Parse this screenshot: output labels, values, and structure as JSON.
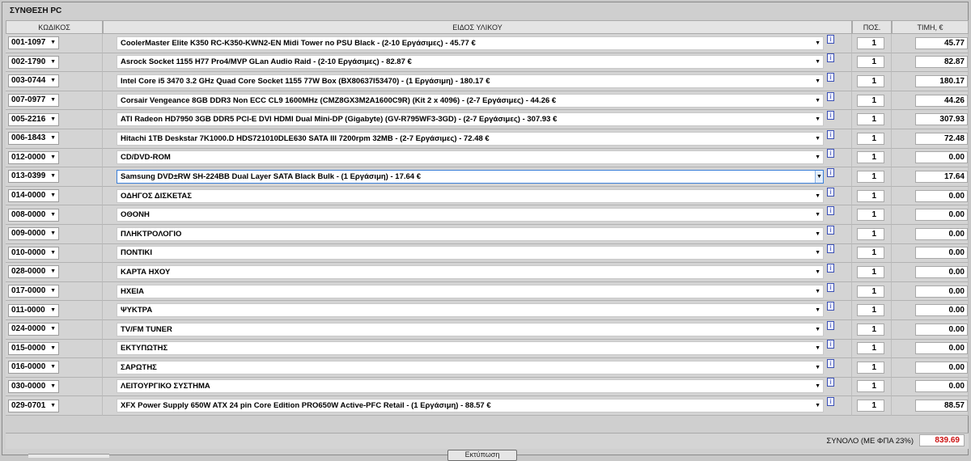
{
  "panel_title": "ΣΥΝΘΕΣΗ PC",
  "columns": {
    "code": "ΚΩΔΙΚΟΣ",
    "item": "ΕΙΔΟΣ ΥΛΙΚΟΥ",
    "qty": "ΠΟΣ.",
    "price": "ΤΙΜΗ, €"
  },
  "info_glyph": "i",
  "rows": [
    {
      "code": "001-1097",
      "item": "CoolerMaster Elite K350 RC-K350-KWN2-EN Midi Tower no PSU Black - (2-10 Εργάσιμες) - 45.77 €",
      "qty": "1",
      "price": "45.77"
    },
    {
      "code": "002-1790",
      "item": "Asrock Socket 1155 H77 Pro4/MVP GLan Audio Raid - (2-10 Εργάσιμες) - 82.87 €",
      "qty": "1",
      "price": "82.87"
    },
    {
      "code": "003-0744",
      "item": "Intel Core i5 3470 3.2 GHz Quad Core Socket 1155 77W Box (BX80637I53470) - (1 Εργάσιμη) - 180.17 €",
      "qty": "1",
      "price": "180.17"
    },
    {
      "code": "007-0977",
      "item": "Corsair Vengeance 8GB DDR3 Non ECC CL9 1600MHz (CMZ8GX3M2A1600C9R) (Kit 2 x 4096) - (2-7 Εργάσιμες) - 44.26 €",
      "qty": "1",
      "price": "44.26"
    },
    {
      "code": "005-2216",
      "item": "ATI Radeon HD7950 3GB DDR5 PCI-E DVI HDMI Dual Mini-DP (Gigabyte) (GV-R795WF3-3GD) - (2-7 Εργάσιμες) - 307.93 €",
      "qty": "1",
      "price": "307.93"
    },
    {
      "code": "006-1843",
      "item": "Hitachi 1TB Deskstar 7K1000.D HDS721010DLE630 SATA III 7200rpm 32MB - (2-7 Εργάσιμες) - 72.48 €",
      "qty": "1",
      "price": "72.48"
    },
    {
      "code": "012-0000",
      "item": "CD/DVD-ROM",
      "qty": "1",
      "price": "0.00"
    },
    {
      "code": "013-0399",
      "item": "Samsung DVD±RW SH-224BB Dual Layer SATA Black Bulk - (1 Εργάσιμη) - 17.64 €",
      "qty": "1",
      "price": "17.64",
      "focused": true
    },
    {
      "code": "014-0000",
      "item": "ΟΔΗΓΟΣ ΔΙΣΚΕΤΑΣ",
      "qty": "1",
      "price": "0.00"
    },
    {
      "code": "008-0000",
      "item": "ΟΘΟΝΗ",
      "qty": "1",
      "price": "0.00"
    },
    {
      "code": "009-0000",
      "item": "ΠΛΗΚΤΡΟΛΟΓΙΟ",
      "qty": "1",
      "price": "0.00"
    },
    {
      "code": "010-0000",
      "item": "ΠΟΝΤΙΚΙ",
      "qty": "1",
      "price": "0.00"
    },
    {
      "code": "028-0000",
      "item": "ΚΑΡΤΑ ΗΧΟΥ",
      "qty": "1",
      "price": "0.00"
    },
    {
      "code": "017-0000",
      "item": "ΗΧΕΙΑ",
      "qty": "1",
      "price": "0.00"
    },
    {
      "code": "011-0000",
      "item": "ΨΥΚΤΡΑ",
      "qty": "1",
      "price": "0.00"
    },
    {
      "code": "024-0000",
      "item": "TV/FM TUNER",
      "qty": "1",
      "price": "0.00"
    },
    {
      "code": "015-0000",
      "item": "ΕΚΤΥΠΩΤΗΣ",
      "qty": "1",
      "price": "0.00"
    },
    {
      "code": "016-0000",
      "item": "ΣΑΡΩΤΗΣ",
      "qty": "1",
      "price": "0.00"
    },
    {
      "code": "030-0000",
      "item": "ΛΕΙΤΟΥΡΓΙΚΟ ΣΥΣΤΗΜΑ",
      "qty": "1",
      "price": "0.00"
    },
    {
      "code": "029-0701",
      "item": "XFX Power Supply 650W ATX 24 pin Core Edition PRO650W Active-PFC Retail - (1 Εργάσιμη) - 88.57 €",
      "qty": "1",
      "price": "88.57"
    }
  ],
  "total": {
    "label": "ΣΥΝΟΛΟ (ΜΕ ΦΠΑ 23%)",
    "value": "839.69",
    "value_color": "#cc1111"
  },
  "bottom_button_label": "Εκτύπωση"
}
